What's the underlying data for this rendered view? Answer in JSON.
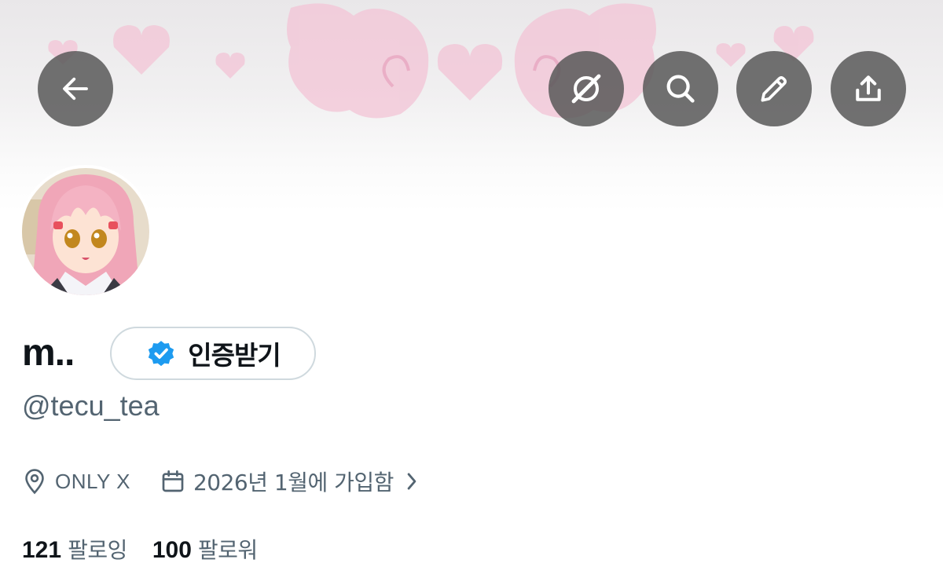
{
  "header": {
    "back_icon": "arrow-left-icon",
    "actions": [
      {
        "name": "grok-icon"
      },
      {
        "name": "search-icon"
      },
      {
        "name": "pencil-icon"
      },
      {
        "name": "share-upload-icon"
      }
    ],
    "button_background": "#585858"
  },
  "banner": {
    "motif": "pink pixel hearts and angel wings",
    "accent": "#f2b8cf"
  },
  "profile": {
    "display_name": "m..",
    "verify_button_label": "인증받기",
    "verified_icon": "verified-badge-icon",
    "verified_color": "#1d9bf0",
    "handle": "@tecu_tea",
    "location": "ONLY X",
    "joined": "2026년 1월에 가입함",
    "following_count": "121",
    "following_label": "팔로잉",
    "followers_count": "100",
    "followers_label": "팔로워"
  },
  "colors": {
    "text_primary": "#0f1419",
    "text_secondary": "#536471",
    "border": "#cfd9de"
  }
}
